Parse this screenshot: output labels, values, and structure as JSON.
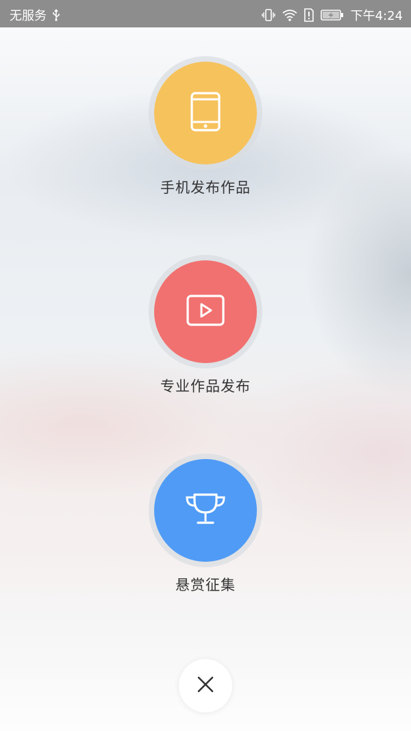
{
  "status_bar": {
    "carrier": "无服务",
    "time": "下午4:24",
    "icons": [
      "usb-icon",
      "vibrate-icon",
      "wifi-icon",
      "sim-alert-icon",
      "battery-charging-icon"
    ]
  },
  "actions": [
    {
      "label": "手机发布作品",
      "icon": "phone-icon",
      "color": "#F6C25C"
    },
    {
      "label": "专业作品发布",
      "icon": "video-play-icon",
      "color": "#F17170"
    },
    {
      "label": "悬赏征集",
      "icon": "trophy-icon",
      "color": "#4F9BF6"
    }
  ],
  "close_button": {
    "icon": "close-icon"
  }
}
